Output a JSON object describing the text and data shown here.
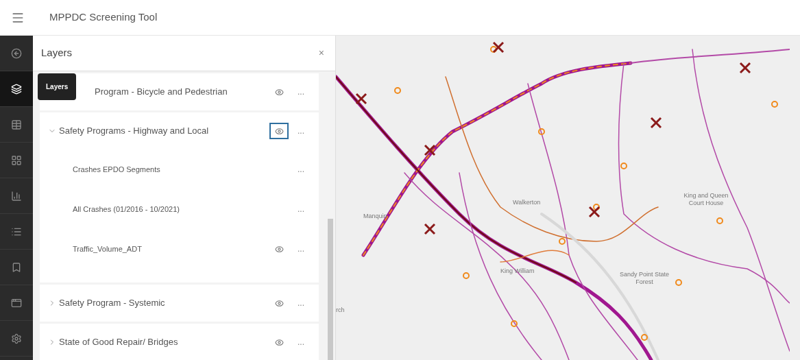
{
  "app_bar": {
    "title": "MPPDC Screening Tool"
  },
  "sidebar": {
    "items": [
      {
        "selected": false
      },
      {
        "selected": true
      },
      {
        "selected": false
      },
      {
        "selected": false
      },
      {
        "selected": false
      },
      {
        "selected": false
      },
      {
        "selected": false
      },
      {
        "selected": false
      },
      {
        "selected": false
      }
    ]
  },
  "tooltip": {
    "text": "Layers"
  },
  "panel": {
    "title": "Layers",
    "close": "×",
    "layers": [
      {
        "name": "Program - Bicycle and Pedestrian",
        "expanded": false,
        "visible": true,
        "focused": false,
        "more": "..."
      },
      {
        "name": "Safety Programs - Highway and Local",
        "expanded": true,
        "visible": true,
        "focused": true,
        "more": "...",
        "children": [
          {
            "name": "Crashes EPDO Segments",
            "visible": false,
            "more": "..."
          },
          {
            "name": "All Crashes (01/2016 - 10/2021)",
            "visible": false,
            "more": "..."
          },
          {
            "name": "Traffic_Volume_ADT",
            "visible": true,
            "more": "..."
          }
        ]
      },
      {
        "name": "Safety Program - Systemic",
        "expanded": false,
        "visible": true,
        "focused": false,
        "more": "..."
      },
      {
        "name": "State of Good Repair/ Bridges",
        "expanded": false,
        "visible": true,
        "focused": false,
        "more": "..."
      }
    ]
  },
  "map": {
    "labels": [
      "Walkerton",
      "King and Queen Court House",
      "King William",
      "Manquin",
      "Sandy Point State Forest",
      "rch"
    ]
  }
}
